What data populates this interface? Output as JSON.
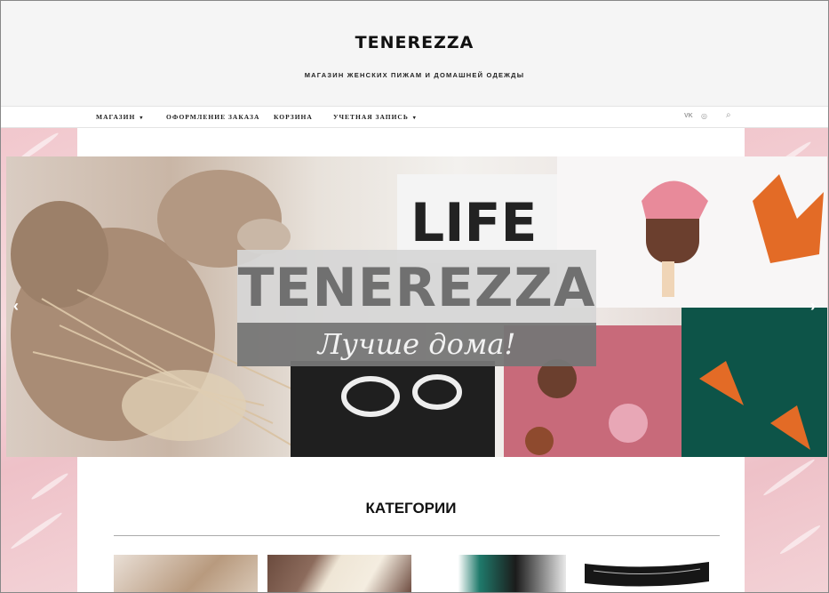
{
  "header": {
    "logo": "TENEREZZA",
    "tagline": "МАГАЗИН ЖЕНСКИХ ПИЖАМ И ДОМАШНЕЙ ОДЕЖДЫ"
  },
  "nav": {
    "items": [
      {
        "label": "МАГАЗИН",
        "has_dropdown": true
      },
      {
        "label": "ОФОРМЛЕНИЕ ЗАКАЗА",
        "has_dropdown": false
      },
      {
        "label": "КОРЗИНА",
        "has_dropdown": false
      },
      {
        "label": "УЧЕТНАЯ ЗАПИСЬ",
        "has_dropdown": true
      }
    ],
    "dropdown_glyph": "▾",
    "icons": [
      {
        "name": "vk-icon",
        "glyph": "VK"
      },
      {
        "name": "instagram-icon",
        "glyph": "◎"
      },
      {
        "name": "search-icon",
        "glyph": "⌕"
      }
    ]
  },
  "hero": {
    "brand": "TENEREZZA",
    "slogan": "Лучше дома!",
    "prev_glyph": "‹",
    "next_glyph": "›"
  },
  "categories": {
    "title": "КАТЕГОРИИ",
    "thumbnails": [
      "category-1",
      "category-2",
      "category-3",
      "category-4"
    ]
  },
  "colors": {
    "accent_pink": "#f1c7cd",
    "banner_light": "#d6d6d6",
    "banner_dark": "#767676"
  }
}
